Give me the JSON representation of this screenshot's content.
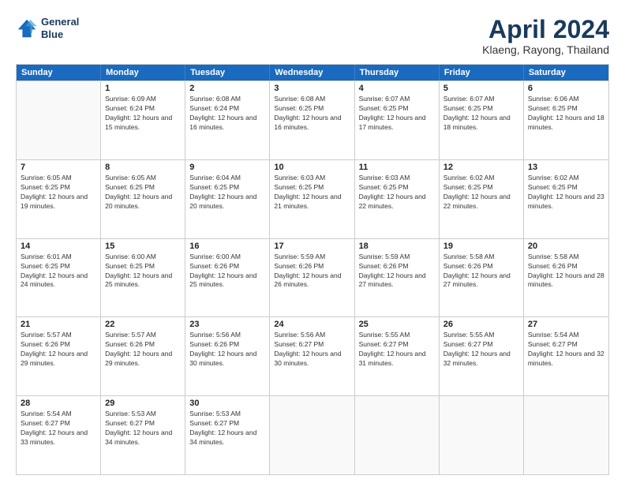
{
  "header": {
    "logo_line1": "General",
    "logo_line2": "Blue",
    "month": "April 2024",
    "location": "Klaeng, Rayong, Thailand"
  },
  "calendar": {
    "days_of_week": [
      "Sunday",
      "Monday",
      "Tuesday",
      "Wednesday",
      "Thursday",
      "Friday",
      "Saturday"
    ],
    "rows": [
      [
        {
          "day": "",
          "sunrise": "",
          "sunset": "",
          "daylight": ""
        },
        {
          "day": "1",
          "sunrise": "Sunrise: 6:09 AM",
          "sunset": "Sunset: 6:24 PM",
          "daylight": "Daylight: 12 hours and 15 minutes."
        },
        {
          "day": "2",
          "sunrise": "Sunrise: 6:08 AM",
          "sunset": "Sunset: 6:24 PM",
          "daylight": "Daylight: 12 hours and 16 minutes."
        },
        {
          "day": "3",
          "sunrise": "Sunrise: 6:08 AM",
          "sunset": "Sunset: 6:25 PM",
          "daylight": "Daylight: 12 hours and 16 minutes."
        },
        {
          "day": "4",
          "sunrise": "Sunrise: 6:07 AM",
          "sunset": "Sunset: 6:25 PM",
          "daylight": "Daylight: 12 hours and 17 minutes."
        },
        {
          "day": "5",
          "sunrise": "Sunrise: 6:07 AM",
          "sunset": "Sunset: 6:25 PM",
          "daylight": "Daylight: 12 hours and 18 minutes."
        },
        {
          "day": "6",
          "sunrise": "Sunrise: 6:06 AM",
          "sunset": "Sunset: 6:25 PM",
          "daylight": "Daylight: 12 hours and 18 minutes."
        }
      ],
      [
        {
          "day": "7",
          "sunrise": "Sunrise: 6:05 AM",
          "sunset": "Sunset: 6:25 PM",
          "daylight": "Daylight: 12 hours and 19 minutes."
        },
        {
          "day": "8",
          "sunrise": "Sunrise: 6:05 AM",
          "sunset": "Sunset: 6:25 PM",
          "daylight": "Daylight: 12 hours and 20 minutes."
        },
        {
          "day": "9",
          "sunrise": "Sunrise: 6:04 AM",
          "sunset": "Sunset: 6:25 PM",
          "daylight": "Daylight: 12 hours and 20 minutes."
        },
        {
          "day": "10",
          "sunrise": "Sunrise: 6:03 AM",
          "sunset": "Sunset: 6:25 PM",
          "daylight": "Daylight: 12 hours and 21 minutes."
        },
        {
          "day": "11",
          "sunrise": "Sunrise: 6:03 AM",
          "sunset": "Sunset: 6:25 PM",
          "daylight": "Daylight: 12 hours and 22 minutes."
        },
        {
          "day": "12",
          "sunrise": "Sunrise: 6:02 AM",
          "sunset": "Sunset: 6:25 PM",
          "daylight": "Daylight: 12 hours and 22 minutes."
        },
        {
          "day": "13",
          "sunrise": "Sunrise: 6:02 AM",
          "sunset": "Sunset: 6:25 PM",
          "daylight": "Daylight: 12 hours and 23 minutes."
        }
      ],
      [
        {
          "day": "14",
          "sunrise": "Sunrise: 6:01 AM",
          "sunset": "Sunset: 6:25 PM",
          "daylight": "Daylight: 12 hours and 24 minutes."
        },
        {
          "day": "15",
          "sunrise": "Sunrise: 6:00 AM",
          "sunset": "Sunset: 6:25 PM",
          "daylight": "Daylight: 12 hours and 25 minutes."
        },
        {
          "day": "16",
          "sunrise": "Sunrise: 6:00 AM",
          "sunset": "Sunset: 6:26 PM",
          "daylight": "Daylight: 12 hours and 25 minutes."
        },
        {
          "day": "17",
          "sunrise": "Sunrise: 5:59 AM",
          "sunset": "Sunset: 6:26 PM",
          "daylight": "Daylight: 12 hours and 26 minutes."
        },
        {
          "day": "18",
          "sunrise": "Sunrise: 5:59 AM",
          "sunset": "Sunset: 6:26 PM",
          "daylight": "Daylight: 12 hours and 27 minutes."
        },
        {
          "day": "19",
          "sunrise": "Sunrise: 5:58 AM",
          "sunset": "Sunset: 6:26 PM",
          "daylight": "Daylight: 12 hours and 27 minutes."
        },
        {
          "day": "20",
          "sunrise": "Sunrise: 5:58 AM",
          "sunset": "Sunset: 6:26 PM",
          "daylight": "Daylight: 12 hours and 28 minutes."
        }
      ],
      [
        {
          "day": "21",
          "sunrise": "Sunrise: 5:57 AM",
          "sunset": "Sunset: 6:26 PM",
          "daylight": "Daylight: 12 hours and 29 minutes."
        },
        {
          "day": "22",
          "sunrise": "Sunrise: 5:57 AM",
          "sunset": "Sunset: 6:26 PM",
          "daylight": "Daylight: 12 hours and 29 minutes."
        },
        {
          "day": "23",
          "sunrise": "Sunrise: 5:56 AM",
          "sunset": "Sunset: 6:26 PM",
          "daylight": "Daylight: 12 hours and 30 minutes."
        },
        {
          "day": "24",
          "sunrise": "Sunrise: 5:56 AM",
          "sunset": "Sunset: 6:27 PM",
          "daylight": "Daylight: 12 hours and 30 minutes."
        },
        {
          "day": "25",
          "sunrise": "Sunrise: 5:55 AM",
          "sunset": "Sunset: 6:27 PM",
          "daylight": "Daylight: 12 hours and 31 minutes."
        },
        {
          "day": "26",
          "sunrise": "Sunrise: 5:55 AM",
          "sunset": "Sunset: 6:27 PM",
          "daylight": "Daylight: 12 hours and 32 minutes."
        },
        {
          "day": "27",
          "sunrise": "Sunrise: 5:54 AM",
          "sunset": "Sunset: 6:27 PM",
          "daylight": "Daylight: 12 hours and 32 minutes."
        }
      ],
      [
        {
          "day": "28",
          "sunrise": "Sunrise: 5:54 AM",
          "sunset": "Sunset: 6:27 PM",
          "daylight": "Daylight: 12 hours and 33 minutes."
        },
        {
          "day": "29",
          "sunrise": "Sunrise: 5:53 AM",
          "sunset": "Sunset: 6:27 PM",
          "daylight": "Daylight: 12 hours and 34 minutes."
        },
        {
          "day": "30",
          "sunrise": "Sunrise: 5:53 AM",
          "sunset": "Sunset: 6:27 PM",
          "daylight": "Daylight: 12 hours and 34 minutes."
        },
        {
          "day": "",
          "sunrise": "",
          "sunset": "",
          "daylight": ""
        },
        {
          "day": "",
          "sunrise": "",
          "sunset": "",
          "daylight": ""
        },
        {
          "day": "",
          "sunrise": "",
          "sunset": "",
          "daylight": ""
        },
        {
          "day": "",
          "sunrise": "",
          "sunset": "",
          "daylight": ""
        }
      ]
    ]
  }
}
